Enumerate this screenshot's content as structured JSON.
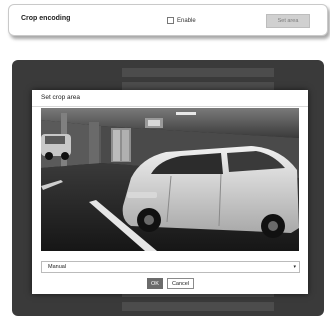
{
  "crop_encoding": {
    "label": "Crop encoding",
    "enable_label": "Enable",
    "enable_checked": false,
    "set_area_label": "Set area"
  },
  "dialog": {
    "title": "Set crop area",
    "mode_value": "Manual",
    "ok_label": "OK",
    "cancel_label": "Cancel"
  }
}
